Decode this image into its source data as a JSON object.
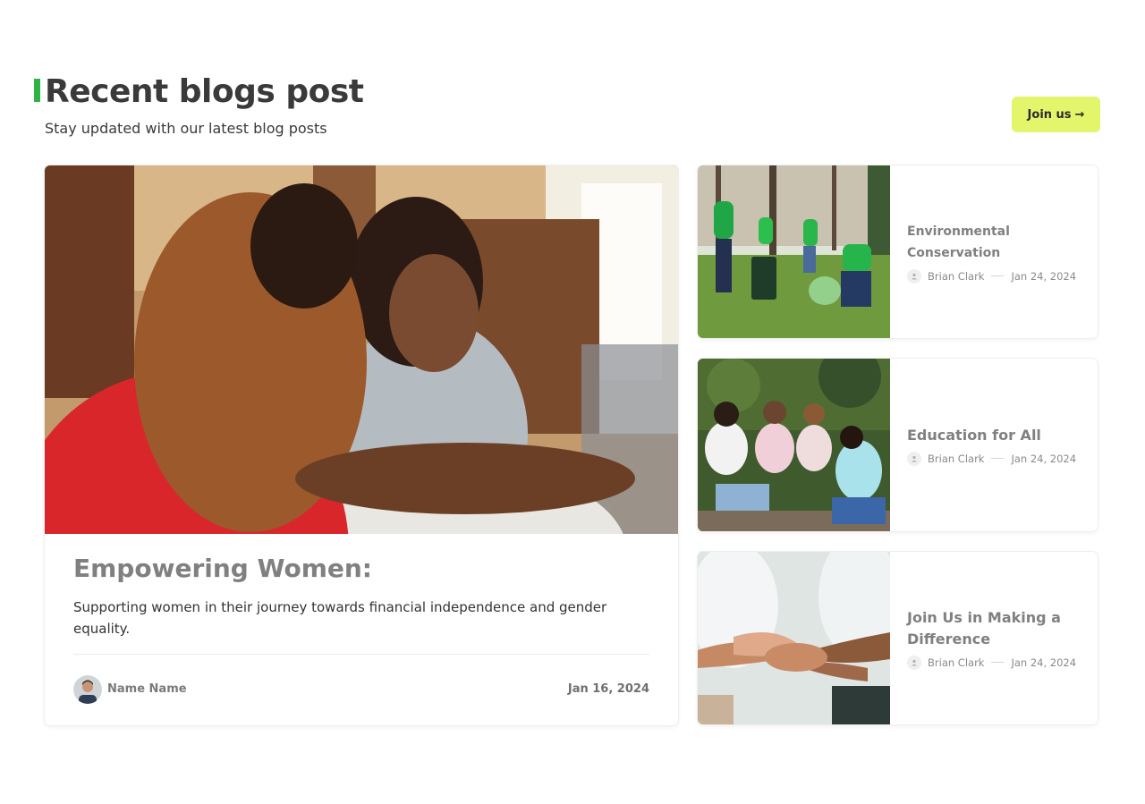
{
  "header": {
    "title": "Recent blogs post",
    "subtitle": "Stay updated with our latest blog posts",
    "join_label": "Join us",
    "join_arrow": "→",
    "accent_color": "#2fb344",
    "button_color": "#e3f56b"
  },
  "featured": {
    "title": "Empowering Women:",
    "description": "Supporting women in their journey towards financial independence and gender equality.",
    "author": "Name Name",
    "date": "Jan 16, 2024"
  },
  "posts": [
    {
      "title": "Environmental Conservation",
      "author": "Brian Clark",
      "date": "Jan 24, 2024"
    },
    {
      "title": "Education for All",
      "author": "Brian Clark",
      "date": "Jan 24, 2024"
    },
    {
      "title": "Join Us in Making a Difference",
      "author": "Brian Clark",
      "date": "Jan 24, 2024"
    }
  ],
  "icons": {
    "author": "user-icon",
    "arrow": "arrow-right-icon"
  }
}
